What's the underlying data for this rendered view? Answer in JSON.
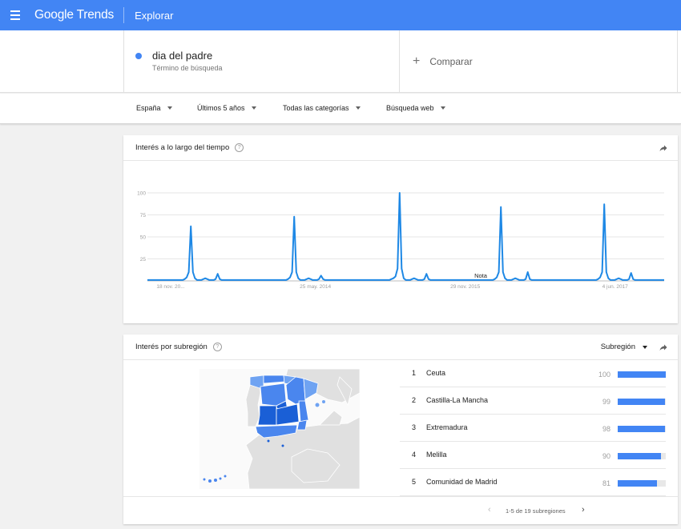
{
  "header": {
    "logo": "Google Trends",
    "page_title": "Explorar"
  },
  "search": {
    "term": "dia del padre",
    "term_type": "Término de búsqueda",
    "term_color": "#4285f4",
    "compare_label": "Comparar"
  },
  "filters": {
    "region": "España",
    "time": "Últimos 5 años",
    "category": "Todas las categorías",
    "search_type": "Búsqueda web"
  },
  "interest_over_time": {
    "title": "Interés a lo largo del tiempo",
    "note_label": "Nota",
    "chart_data": {
      "type": "line",
      "title": "Interés a lo largo del tiempo",
      "xlabel": "",
      "ylabel": "",
      "ylim": [
        0,
        100
      ],
      "yticks": [
        25,
        50,
        75,
        100
      ],
      "xticks": [
        "18 nov. 20...",
        "25 may. 2014",
        "29 nov. 2015",
        "4 jun. 2017"
      ],
      "grid": true,
      "series": [
        {
          "color": "#1e88e5",
          "values": [
            1,
            1,
            1,
            1,
            1,
            1,
            1,
            1,
            1,
            1,
            1,
            1,
            1,
            1,
            1,
            1,
            1,
            1,
            2,
            4,
            10,
            62,
            10,
            3,
            1,
            1,
            1,
            2,
            3,
            2,
            1,
            1,
            1,
            2,
            8,
            2,
            1,
            1,
            1,
            1,
            1,
            1,
            1,
            1,
            1,
            1,
            1,
            1,
            1,
            1,
            1,
            1,
            1,
            1,
            1,
            1,
            1,
            1,
            1,
            1,
            1,
            1,
            1,
            1,
            1,
            1,
            1,
            1,
            2,
            4,
            10,
            73,
            10,
            3,
            1,
            1,
            1,
            2,
            3,
            2,
            1,
            1,
            1,
            2,
            6,
            2,
            1,
            1,
            1,
            1,
            1,
            1,
            1,
            1,
            1,
            1,
            1,
            1,
            1,
            1,
            1,
            1,
            1,
            1,
            1,
            1,
            1,
            1,
            1,
            1,
            1,
            1,
            1,
            1,
            1,
            1,
            1,
            1,
            2,
            3,
            5,
            14,
            100,
            14,
            3,
            1,
            1,
            1,
            2,
            3,
            2,
            1,
            1,
            1,
            2,
            8,
            2,
            1,
            1,
            1,
            1,
            1,
            1,
            1,
            1,
            1,
            1,
            1,
            1,
            1,
            1,
            1,
            1,
            1,
            1,
            1,
            1,
            1,
            1,
            1,
            1,
            1,
            1,
            1,
            1,
            1,
            1,
            1,
            2,
            4,
            10,
            84,
            10,
            3,
            1,
            1,
            1,
            2,
            3,
            2,
            1,
            1,
            1,
            2,
            10,
            2,
            1,
            1,
            1,
            1,
            1,
            1,
            1,
            1,
            1,
            1,
            1,
            1,
            1,
            1,
            1,
            1,
            1,
            1,
            1,
            1,
            1,
            1,
            1,
            1,
            1,
            1,
            1,
            1,
            1,
            1,
            1,
            1,
            2,
            4,
            10,
            87,
            10,
            3,
            1,
            1,
            1,
            2,
            3,
            2,
            1,
            1,
            1,
            2,
            9,
            2,
            1,
            1,
            1,
            1,
            1,
            1,
            1,
            1,
            1,
            1,
            1,
            1,
            1,
            1,
            1
          ]
        }
      ]
    }
  },
  "interest_by_region": {
    "title": "Interés por subregión",
    "resolution_label": "Subregión",
    "rows": [
      {
        "rank": "1",
        "name": "Ceuta",
        "value": "100",
        "fraction": 1.0
      },
      {
        "rank": "2",
        "name": "Castilla-La Mancha",
        "value": "99",
        "fraction": 0.99
      },
      {
        "rank": "3",
        "name": "Extremadura",
        "value": "98",
        "fraction": 0.98
      },
      {
        "rank": "4",
        "name": "Melilla",
        "value": "90",
        "fraction": 0.9
      },
      {
        "rank": "5",
        "name": "Comunidad de Madrid",
        "value": "81",
        "fraction": 0.81
      }
    ],
    "pager_text": "1-5 de 19 subregiones",
    "map_colors": {
      "light": "#e0e0e0",
      "low": "#6fa3f2",
      "mid": "#4a86ee",
      "high": "#1a5fd6"
    }
  }
}
